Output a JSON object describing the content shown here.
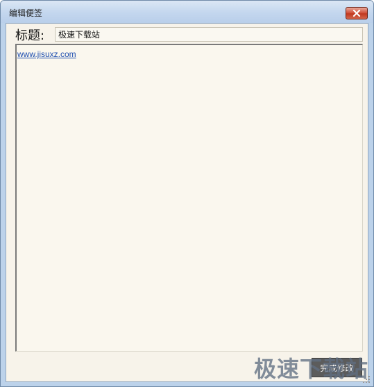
{
  "window": {
    "title": "编辑便签"
  },
  "form": {
    "title_label": "标题:",
    "title_value": "极速下载站"
  },
  "content": {
    "link_text": "www.jisuxz.com"
  },
  "actions": {
    "save_label": "完成修改"
  },
  "watermark": {
    "text": "极速下载站"
  },
  "colors": {
    "titlebar": "#c3d6ee",
    "client_bg": "#f7f3ea",
    "link": "#1f4fb0",
    "close_button": "#c0381f",
    "save_button": "#5c5c5c"
  },
  "icons": {
    "close": "close-icon",
    "resize": "resize-grip-icon"
  }
}
